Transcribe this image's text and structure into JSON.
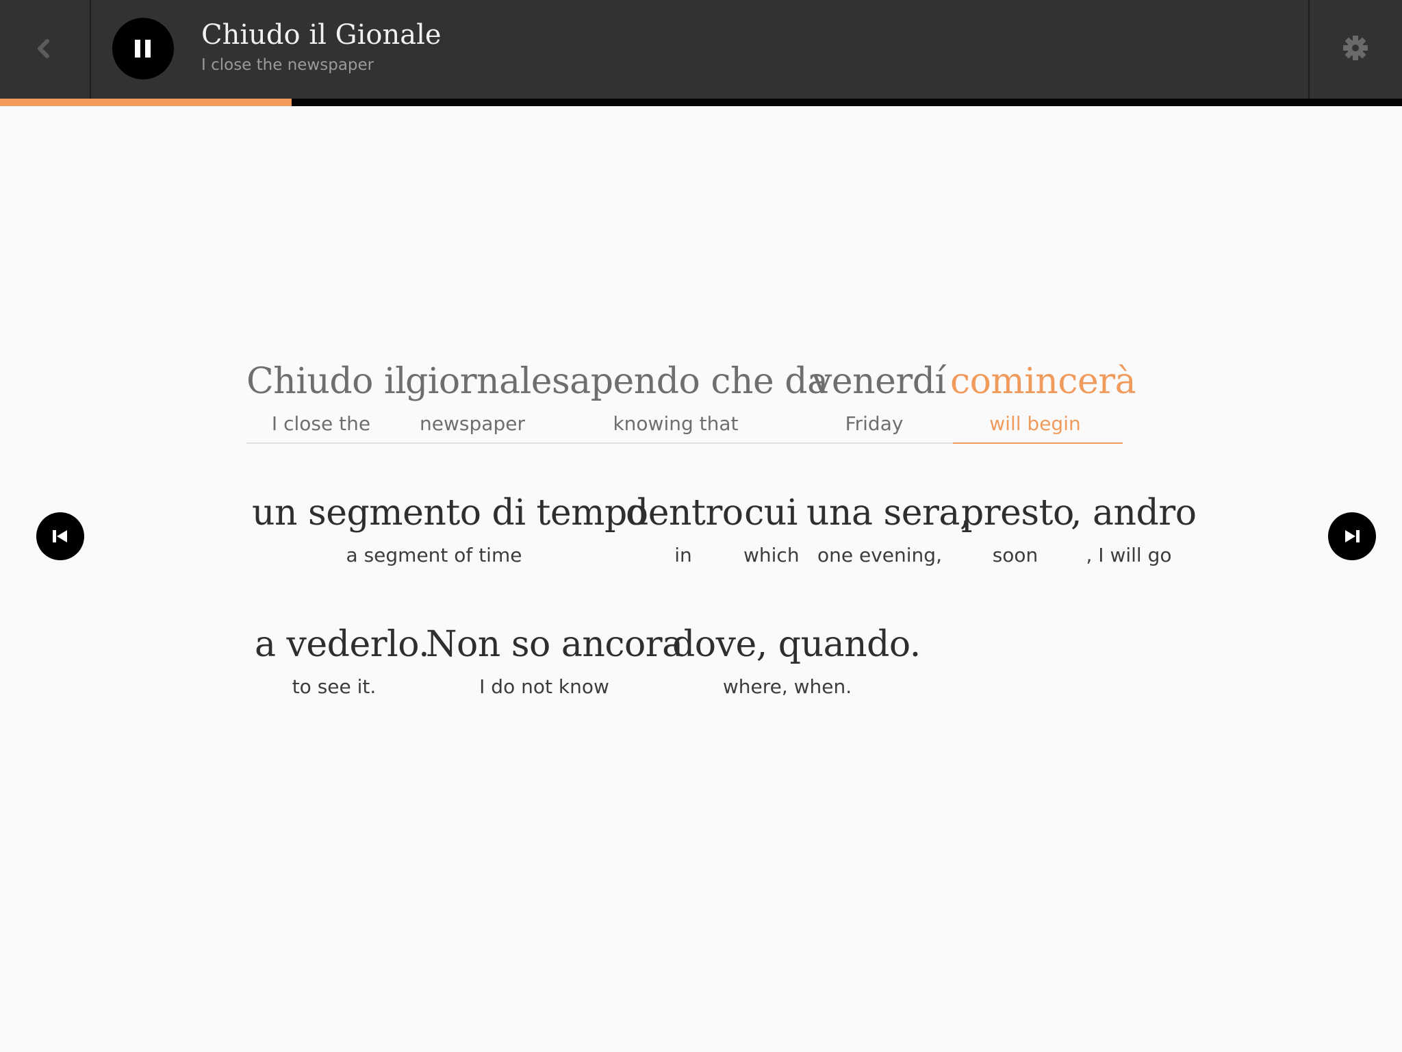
{
  "header": {
    "title": "Chiudo il Gionale",
    "subtitle": "I close the newspaper",
    "back_icon": "chevron-left-icon",
    "play_state_icon": "pause-icon",
    "settings_icon": "gear-icon"
  },
  "playback": {
    "progress_fraction": 0.208,
    "accent_color": "#f09a5c"
  },
  "lines": [
    {
      "words": [
        {
          "it": "Chiudo il",
          "en": "I close the"
        },
        {
          "it": "giornale",
          "en": "newspaper"
        },
        {
          "it": "sapendo che da",
          "en": "knowing that"
        },
        {
          "it": "venerdí",
          "en": "Friday"
        },
        {
          "it": "comincerà",
          "en": "will begin",
          "current": true
        }
      ]
    },
    {
      "words": [
        {
          "it": "un segmento di tempo",
          "en": "a segment of time"
        },
        {
          "it": "dentro",
          "en": "in"
        },
        {
          "it": "cui",
          "en": "which"
        },
        {
          "it": "una sera,",
          "en": "one evening,"
        },
        {
          "it": "presto",
          "en": "soon"
        },
        {
          "it": ", andro",
          "en": ", I will go"
        }
      ]
    },
    {
      "words": [
        {
          "it": "a vederlo.",
          "en": "to see it."
        },
        {
          "it": "Non so ancora",
          "en": "I do not know"
        },
        {
          "it": "dove, quando.",
          "en": "where, when."
        }
      ]
    }
  ],
  "navigation": {
    "previous_icon": "skip-previous-icon",
    "next_icon": "skip-next-icon"
  }
}
